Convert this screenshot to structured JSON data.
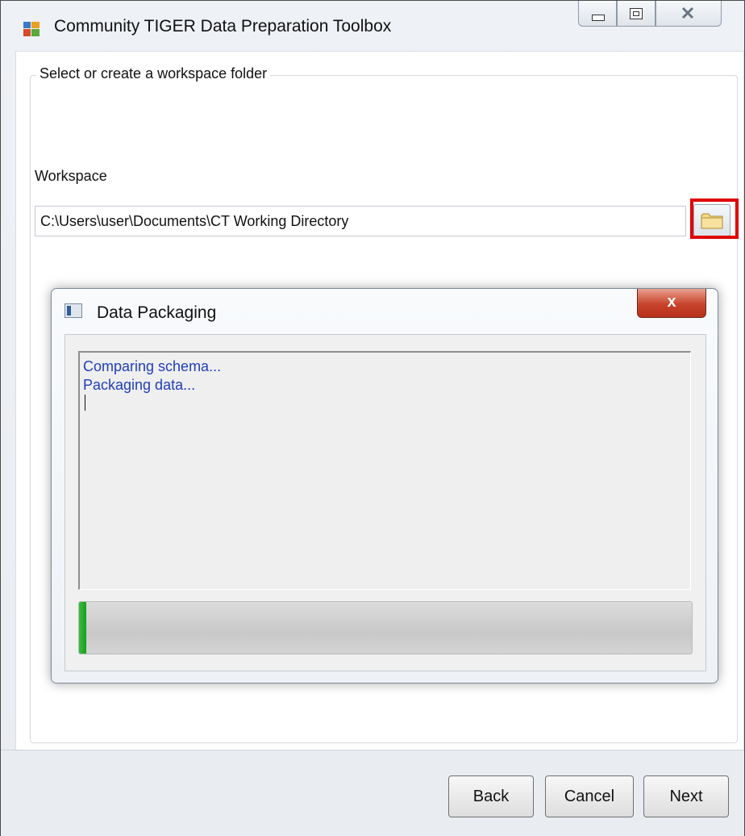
{
  "window": {
    "title": "Community TIGER Data Preparation Toolbox"
  },
  "workspace": {
    "group_title": "Select or create a workspace folder",
    "label": "Workspace",
    "path": "C:\\Users\\user\\Documents\\CT Working Directory"
  },
  "dialog": {
    "title": "Data Packaging",
    "close_label": "x",
    "log_lines": [
      "Comparing schema...",
      "Packaging data..."
    ],
    "progress": 0.01
  },
  "buttons": {
    "back": "Back",
    "cancel": "Cancel",
    "next": "Next"
  },
  "icons": {
    "app": "app-window-icon",
    "browse": "folder-icon",
    "dialog": "dialog-window-icon"
  },
  "colors": {
    "highlight": "#e00000",
    "log_text": "#1f3fb8",
    "progress": "#14a01a"
  }
}
